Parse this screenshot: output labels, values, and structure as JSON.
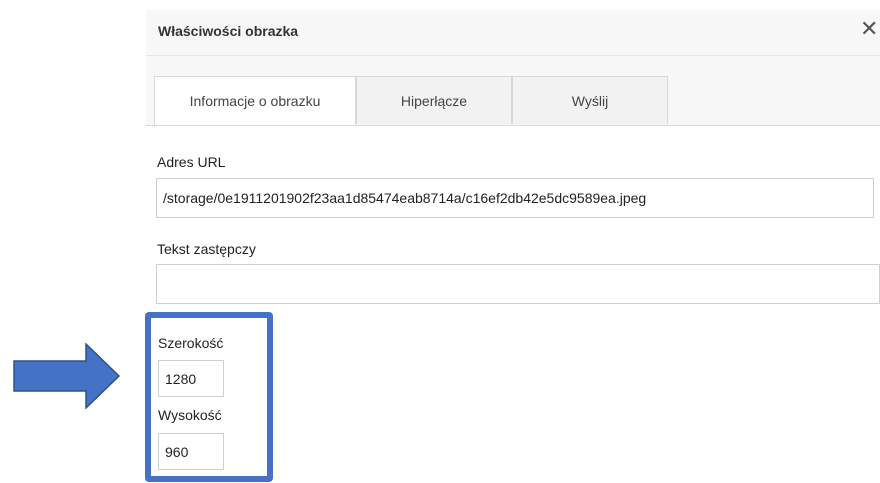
{
  "dialog": {
    "title": "Właściwości obrazka",
    "close_icon": "close-icon"
  },
  "tabs": [
    {
      "label": "Informacje o obrazku",
      "active": true
    },
    {
      "label": "Hiperłącze",
      "active": false
    },
    {
      "label": "Wyślij",
      "active": false
    }
  ],
  "form": {
    "url_label": "Adres URL",
    "url_value": "/storage/0e1911201902f23aa1d85474eab8714a/c16ef2db42e5dc9589ea.jpeg",
    "alt_label": "Tekst zastępczy",
    "alt_value": "",
    "width_label": "Szerokość",
    "width_value": "1280",
    "height_label": "Wysokość",
    "height_value": "960"
  },
  "annotation": {
    "arrow_icon": "right-arrow-icon",
    "highlight_color": "#4472c4"
  }
}
